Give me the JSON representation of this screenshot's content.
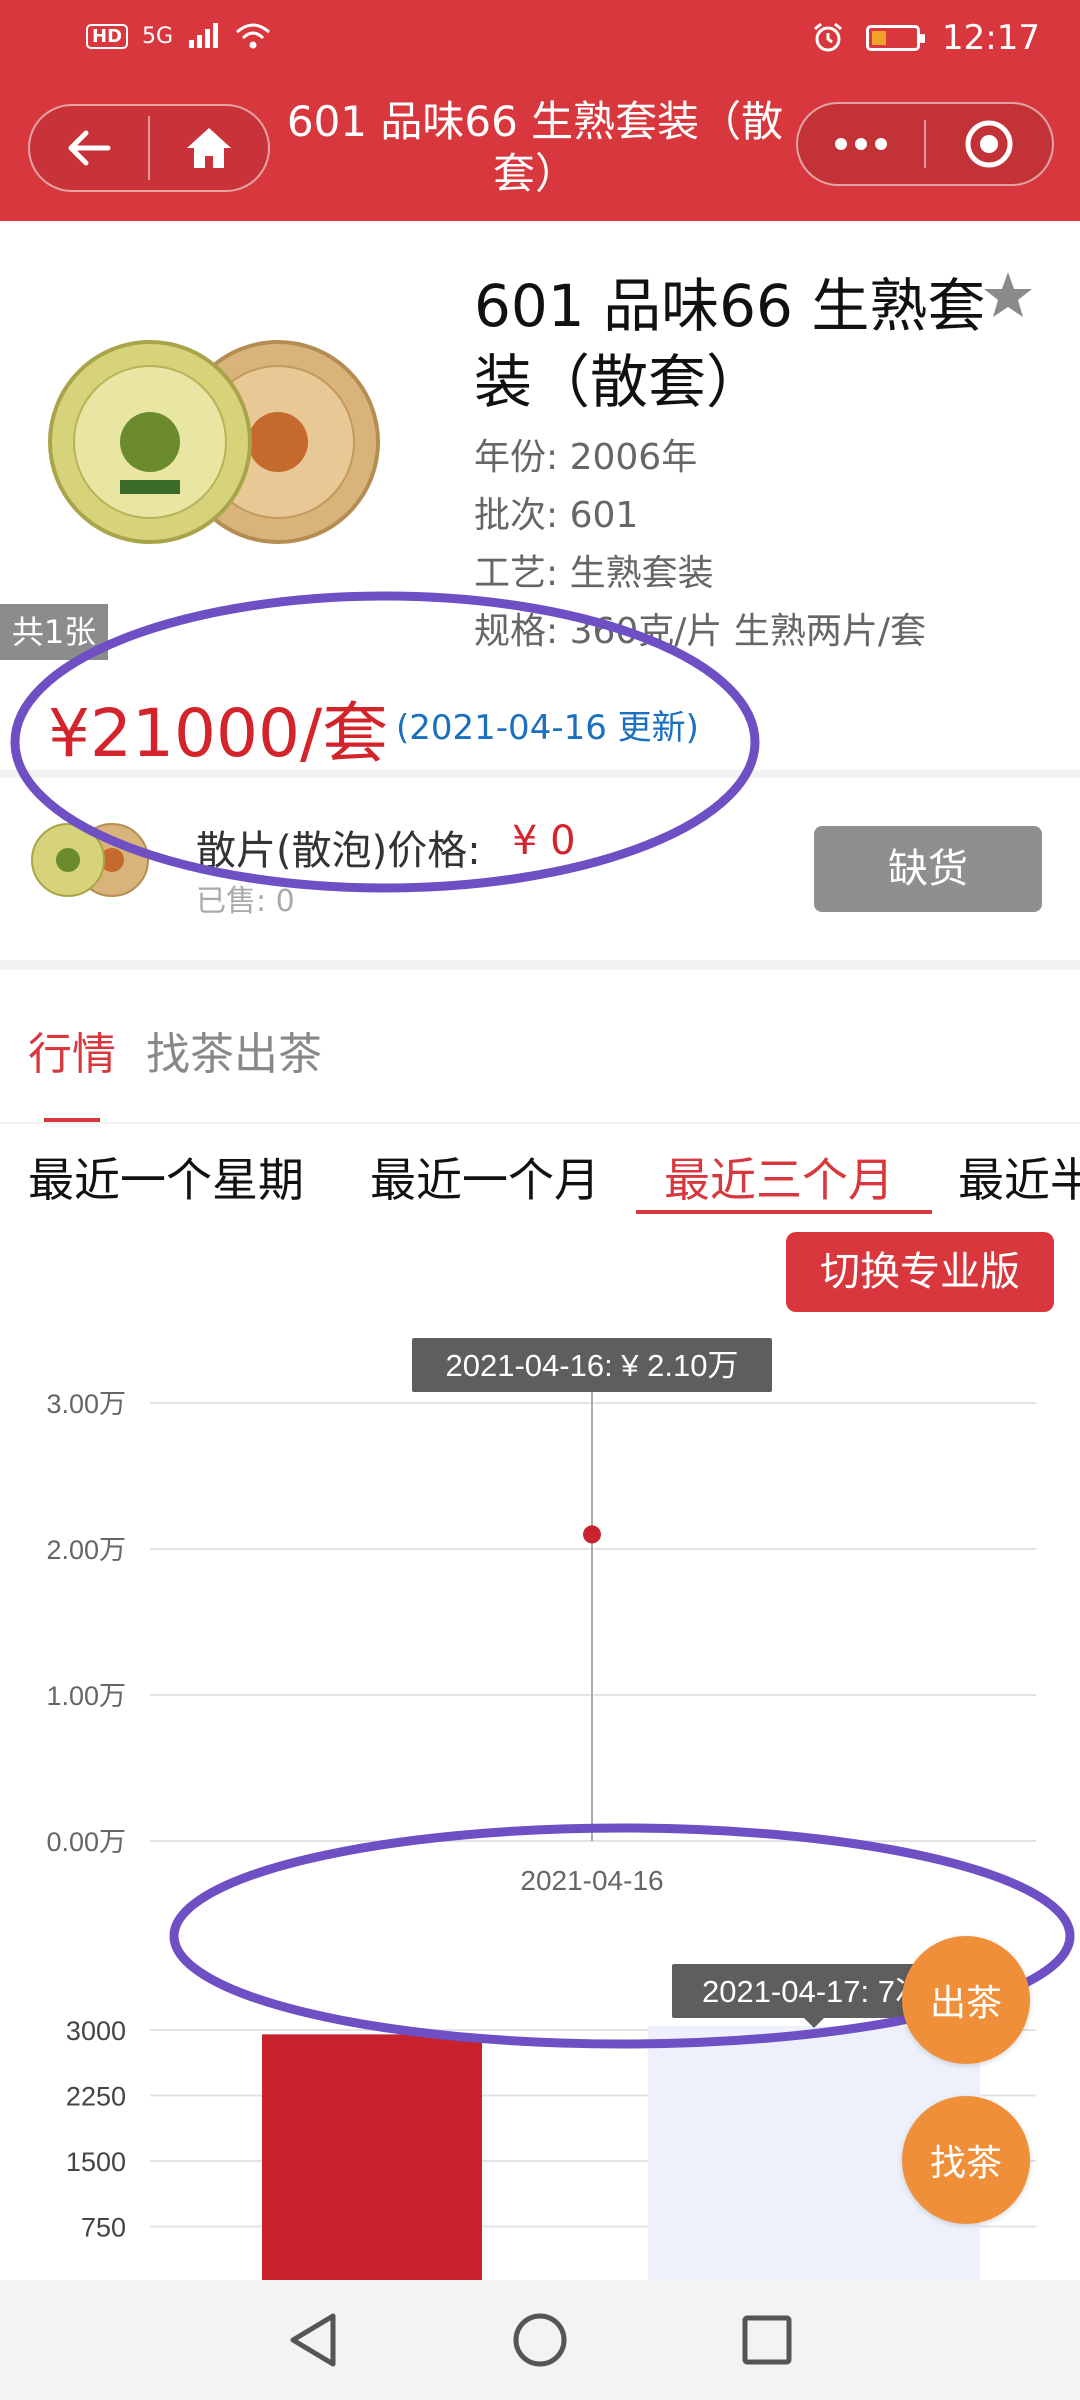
{
  "status_bar": {
    "hd": "HD",
    "network": "5G",
    "time": "12:17"
  },
  "header": {
    "title": "601 品味66 生熟套装（散套）"
  },
  "product": {
    "title": "601 品味66 生熟套装（散套）",
    "attrs": [
      {
        "label": "年份:",
        "value": "2006年"
      },
      {
        "label": "批次:",
        "value": "601"
      },
      {
        "label": "工艺:",
        "value": "生熟套装"
      },
      {
        "label": "规格:",
        "value": "360克/片 生熟两片/套"
      }
    ],
    "count_badge": "共1张",
    "price": "¥21000/套",
    "price_date": "(2021-04-16 更新)"
  },
  "loose": {
    "label": "散片(散泡)价格:",
    "price": "¥ 0",
    "sold": "已售: 0",
    "button": "缺货"
  },
  "tabs": [
    {
      "label": "行情",
      "active": true
    },
    {
      "label": "找茶出茶",
      "active": false
    }
  ],
  "subtabs": [
    {
      "label": "最近一个星期",
      "active": false
    },
    {
      "label": "最近一个月",
      "active": false
    },
    {
      "label": "最近三个月",
      "active": true
    },
    {
      "label": "最近半",
      "active": false
    }
  ],
  "pro_button": "切换专业版",
  "float_buttons": {
    "sell": "出茶",
    "find": "找茶"
  },
  "colors": {
    "header_red": "#d8383d",
    "price_red": "#d3242b",
    "date_blue": "#1a6fbf",
    "orange": "#f08f3a",
    "annotation_purple": "#6e4fc4"
  },
  "chart_data": [
    {
      "type": "scatter",
      "x": [
        "2021-04-16"
      ],
      "values": [
        2.1
      ],
      "yticks": [
        "3.00万",
        "2.00万",
        "1.00万",
        "0.00万"
      ],
      "ylim": [
        0,
        3
      ],
      "tooltip": "2021-04-16: ¥ 2.10万",
      "grid": true
    },
    {
      "type": "bar",
      "yticks": [
        "3000",
        "2250",
        "1500",
        "750"
      ],
      "values": [
        2950
      ],
      "ylim": [
        0,
        3000
      ],
      "tooltip": "2021-04-17: 7次",
      "grid": true
    }
  ]
}
